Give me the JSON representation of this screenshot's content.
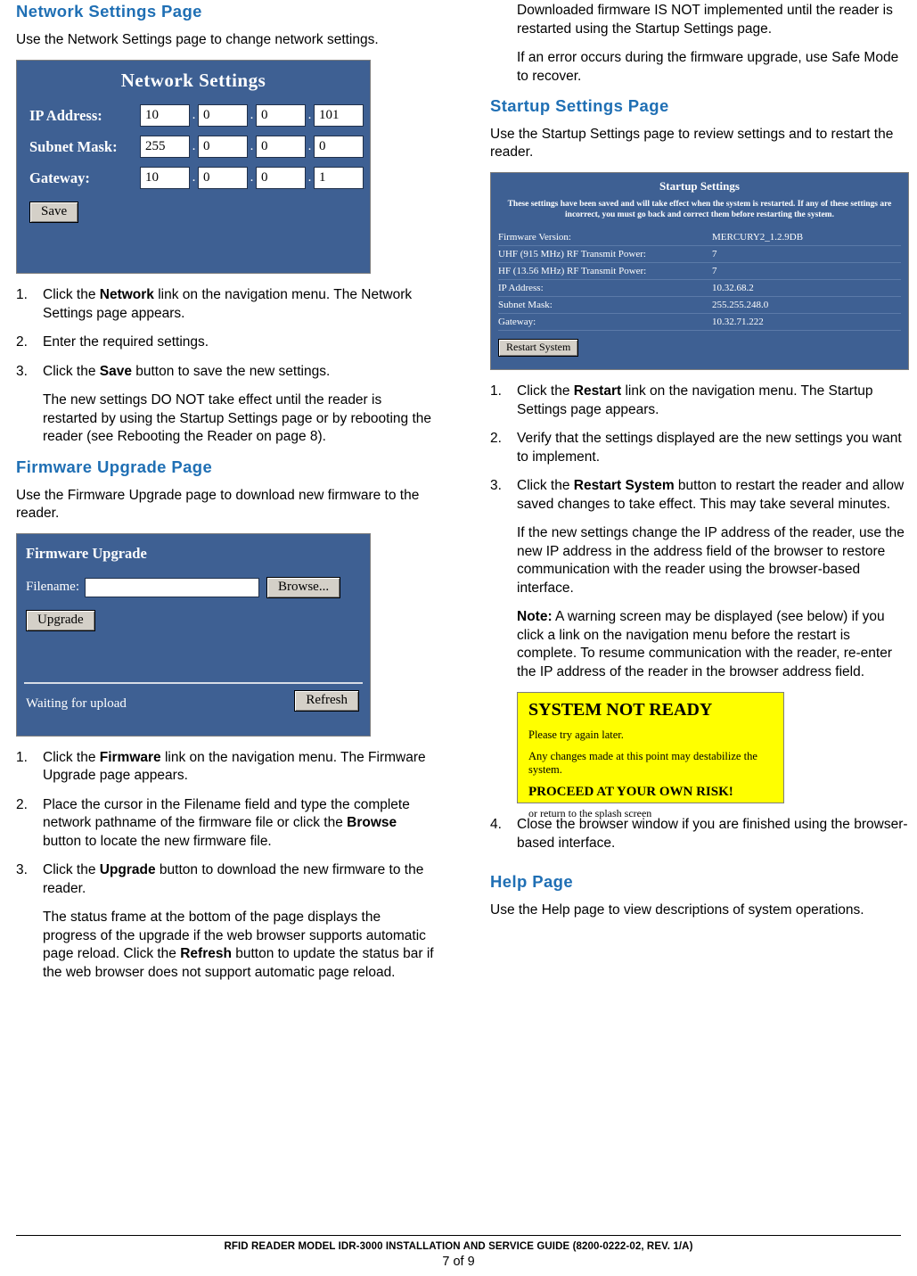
{
  "left": {
    "heading_network": "Network Settings Page",
    "intro_network": "Use the Network Settings page to change network settings.",
    "network_shot": {
      "title": "Network Settings",
      "rows": [
        {
          "label": "IP Address:",
          "octets": [
            "10",
            "0",
            "0",
            "101"
          ]
        },
        {
          "label": "Subnet Mask:",
          "octets": [
            "255",
            "0",
            "0",
            "0"
          ]
        },
        {
          "label": "Gateway:",
          "octets": [
            "10",
            "0",
            "0",
            "1"
          ]
        }
      ],
      "save_button": "Save"
    },
    "network_steps": [
      {
        "num": "1.",
        "text_pre": "Click the ",
        "bold": "Network",
        "text_post": " link on the navigation menu. The Network Settings page appears."
      },
      {
        "num": "2.",
        "text_pre": "Enter the required settings.",
        "bold": "",
        "text_post": ""
      },
      {
        "num": "3.",
        "text_pre": "Click the ",
        "bold": "Save",
        "text_post": " button to save the new settings."
      }
    ],
    "network_note": "The new settings DO NOT take effect until the reader is restarted by using the Startup Settings page or by rebooting the reader (see Rebooting the Reader on page 8).",
    "heading_firmware": "Firmware Upgrade Page",
    "intro_firmware": "Use the Firmware Upgrade page to download new firmware to the reader.",
    "firmware_shot": {
      "title": "Firmware Upgrade",
      "filename_label": "Filename:",
      "filename_value": "",
      "browse_button": "Browse...",
      "upgrade_button": "Upgrade",
      "status_text": "Waiting for upload",
      "refresh_button": "Refresh"
    },
    "firmware_steps": [
      {
        "num": "1.",
        "parts": [
          {
            "t": "Click the "
          },
          {
            "t": "Firmware",
            "b": true
          },
          {
            "t": " link on the navigation menu. The Firmware Upgrade page appears."
          }
        ]
      },
      {
        "num": "2.",
        "parts": [
          {
            "t": "Place the cursor in the Filename field and type the complete network pathname of the firmware file or click the "
          },
          {
            "t": "Browse",
            "b": true
          },
          {
            "t": " button to locate the new firmware file."
          }
        ]
      },
      {
        "num": "3.",
        "parts": [
          {
            "t": "Click the "
          },
          {
            "t": "Upgrade",
            "b": true
          },
          {
            "t": " button to download the new firmware to the reader."
          }
        ]
      }
    ],
    "firmware_note_a": "The status frame at the bottom of the page displays the progress of the upgrade if the web browser supports automatic page reload. Click the ",
    "firmware_note_b": "Refresh",
    "firmware_note_c": " button to update the status bar if the web browser does not support automatic page reload."
  },
  "right": {
    "top_note_1": "Downloaded firmware IS NOT implemented until the reader is restarted using the Startup Settings page.",
    "top_note_2": "If an error occurs during the firmware upgrade, use Safe Mode to recover.",
    "heading_startup": "Startup Settings Page",
    "intro_startup": "Use the Startup Settings page to review settings and to restart the reader.",
    "startup_shot": {
      "title": "Startup Settings",
      "warning": "These settings have been saved and will take effect when the system is restarted. If any of these settings are incorrect, you must go back and correct them before restarting the system.",
      "rows": [
        {
          "key": "Firmware Version:",
          "value": "MERCURY2_1.2.9DB"
        },
        {
          "key": "UHF (915 MHz) RF Transmit Power:",
          "value": "7"
        },
        {
          "key": "HF (13.56 MHz) RF Transmit Power:",
          "value": "7"
        },
        {
          "key": "IP Address:",
          "value": "10.32.68.2"
        },
        {
          "key": "Subnet Mask:",
          "value": "255.255.248.0"
        },
        {
          "key": "Gateway:",
          "value": "10.32.71.222"
        }
      ],
      "restart_button": "Restart System"
    },
    "startup_steps": [
      {
        "num": "1.",
        "parts": [
          {
            "t": "Click the "
          },
          {
            "t": "Restart",
            "b": true
          },
          {
            "t": " link on the navigation menu. The Startup Settings page appears."
          }
        ]
      },
      {
        "num": "2.",
        "parts": [
          {
            "t": "Verify that the settings displayed are the new settings you want to implement."
          }
        ]
      },
      {
        "num": "3.",
        "parts": [
          {
            "t": "Click the "
          },
          {
            "t": "Restart System",
            "b": true
          },
          {
            "t": " button to restart the reader and allow saved changes to take effect. This may take several minutes."
          }
        ]
      }
    ],
    "startup_note_1": "If the new settings change the IP address of the reader, use the new IP address in the address field of the browser to restore communication with the reader using the browser-based interface.",
    "startup_note_label": "Note:",
    "startup_note_2": " A warning screen may be displayed (see below) if you click a link on the navigation menu before the restart is complete. To resume communication with the reader, re-enter the IP address of the reader in the browser address field.",
    "warning_shot": {
      "headline": "SYSTEM NOT READY",
      "line1": "Please try again later.",
      "line2": "Any changes made at this point may destabilize the system.",
      "proceed": "PROCEED AT YOUR OWN RISK!",
      "splash": "or return to the splash screen"
    },
    "startup_step_4": {
      "num": "4.",
      "text": "Close the browser window if you are finished using the browser-based interface."
    },
    "heading_help": "Help Page",
    "intro_help": "Use the Help page to view descriptions of system operations."
  },
  "footer": {
    "line1": "RFID READER MODEL IDR-3000 INSTALLATION AND SERVICE GUIDE (8200-0222-02, REV. 1/A)",
    "line2": "7 of 9"
  },
  "colors": {
    "heading_blue": "#1f6fb4",
    "screenshot_blue": "#3e6093",
    "warning_yellow": "#ffff00"
  }
}
